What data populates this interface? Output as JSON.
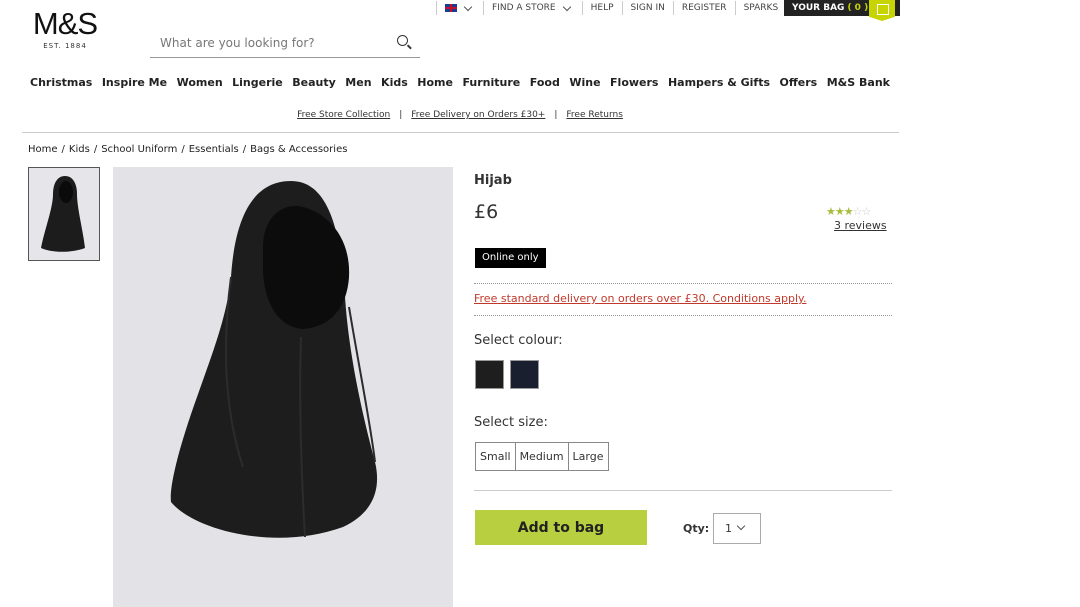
{
  "utility": {
    "language_icon": "uk-flag-icon",
    "find_store": "FIND A STORE",
    "help": "HELP",
    "sign_in": "SIGN IN",
    "register": "REGISTER",
    "sparks": "SPARKS",
    "bag_label": "YOUR BAG",
    "bag_count": "( 0 )"
  },
  "logo": {
    "text": "M&S",
    "est": "EST. 1884"
  },
  "search": {
    "placeholder": "What are you looking for?"
  },
  "nav": [
    "Christmas",
    "Inspire Me",
    "Women",
    "Lingerie",
    "Beauty",
    "Men",
    "Kids",
    "Home",
    "Furniture",
    "Food",
    "Wine",
    "Flowers",
    "Hampers & Gifts",
    "Offers",
    "M&S Bank"
  ],
  "promo": [
    "Free Store Collection",
    "Free Delivery on Orders £30+",
    "Free Returns"
  ],
  "breadcrumb": [
    "Home",
    "Kids",
    "School Uniform",
    "Essentials",
    "Bags & Accessories"
  ],
  "product": {
    "title": "Hijab",
    "price": "£6",
    "rating": 2.5,
    "reviews": "3 reviews",
    "badge": "Online only",
    "delivery": "Free standard delivery on orders over £30. Conditions apply.",
    "colour_label": "Select colour:",
    "colours": [
      "#1e1e1e",
      "#1a1f30"
    ],
    "size_label": "Select size:",
    "sizes": [
      "Small",
      "Medium",
      "Large"
    ],
    "add_to_bag": "Add to bag",
    "qty_label": "Qty:",
    "qty_value": "1"
  },
  "colors": {
    "accent": "#b8cf3f",
    "bag_bg": "#222222",
    "delivery_link": "#c0392b"
  }
}
